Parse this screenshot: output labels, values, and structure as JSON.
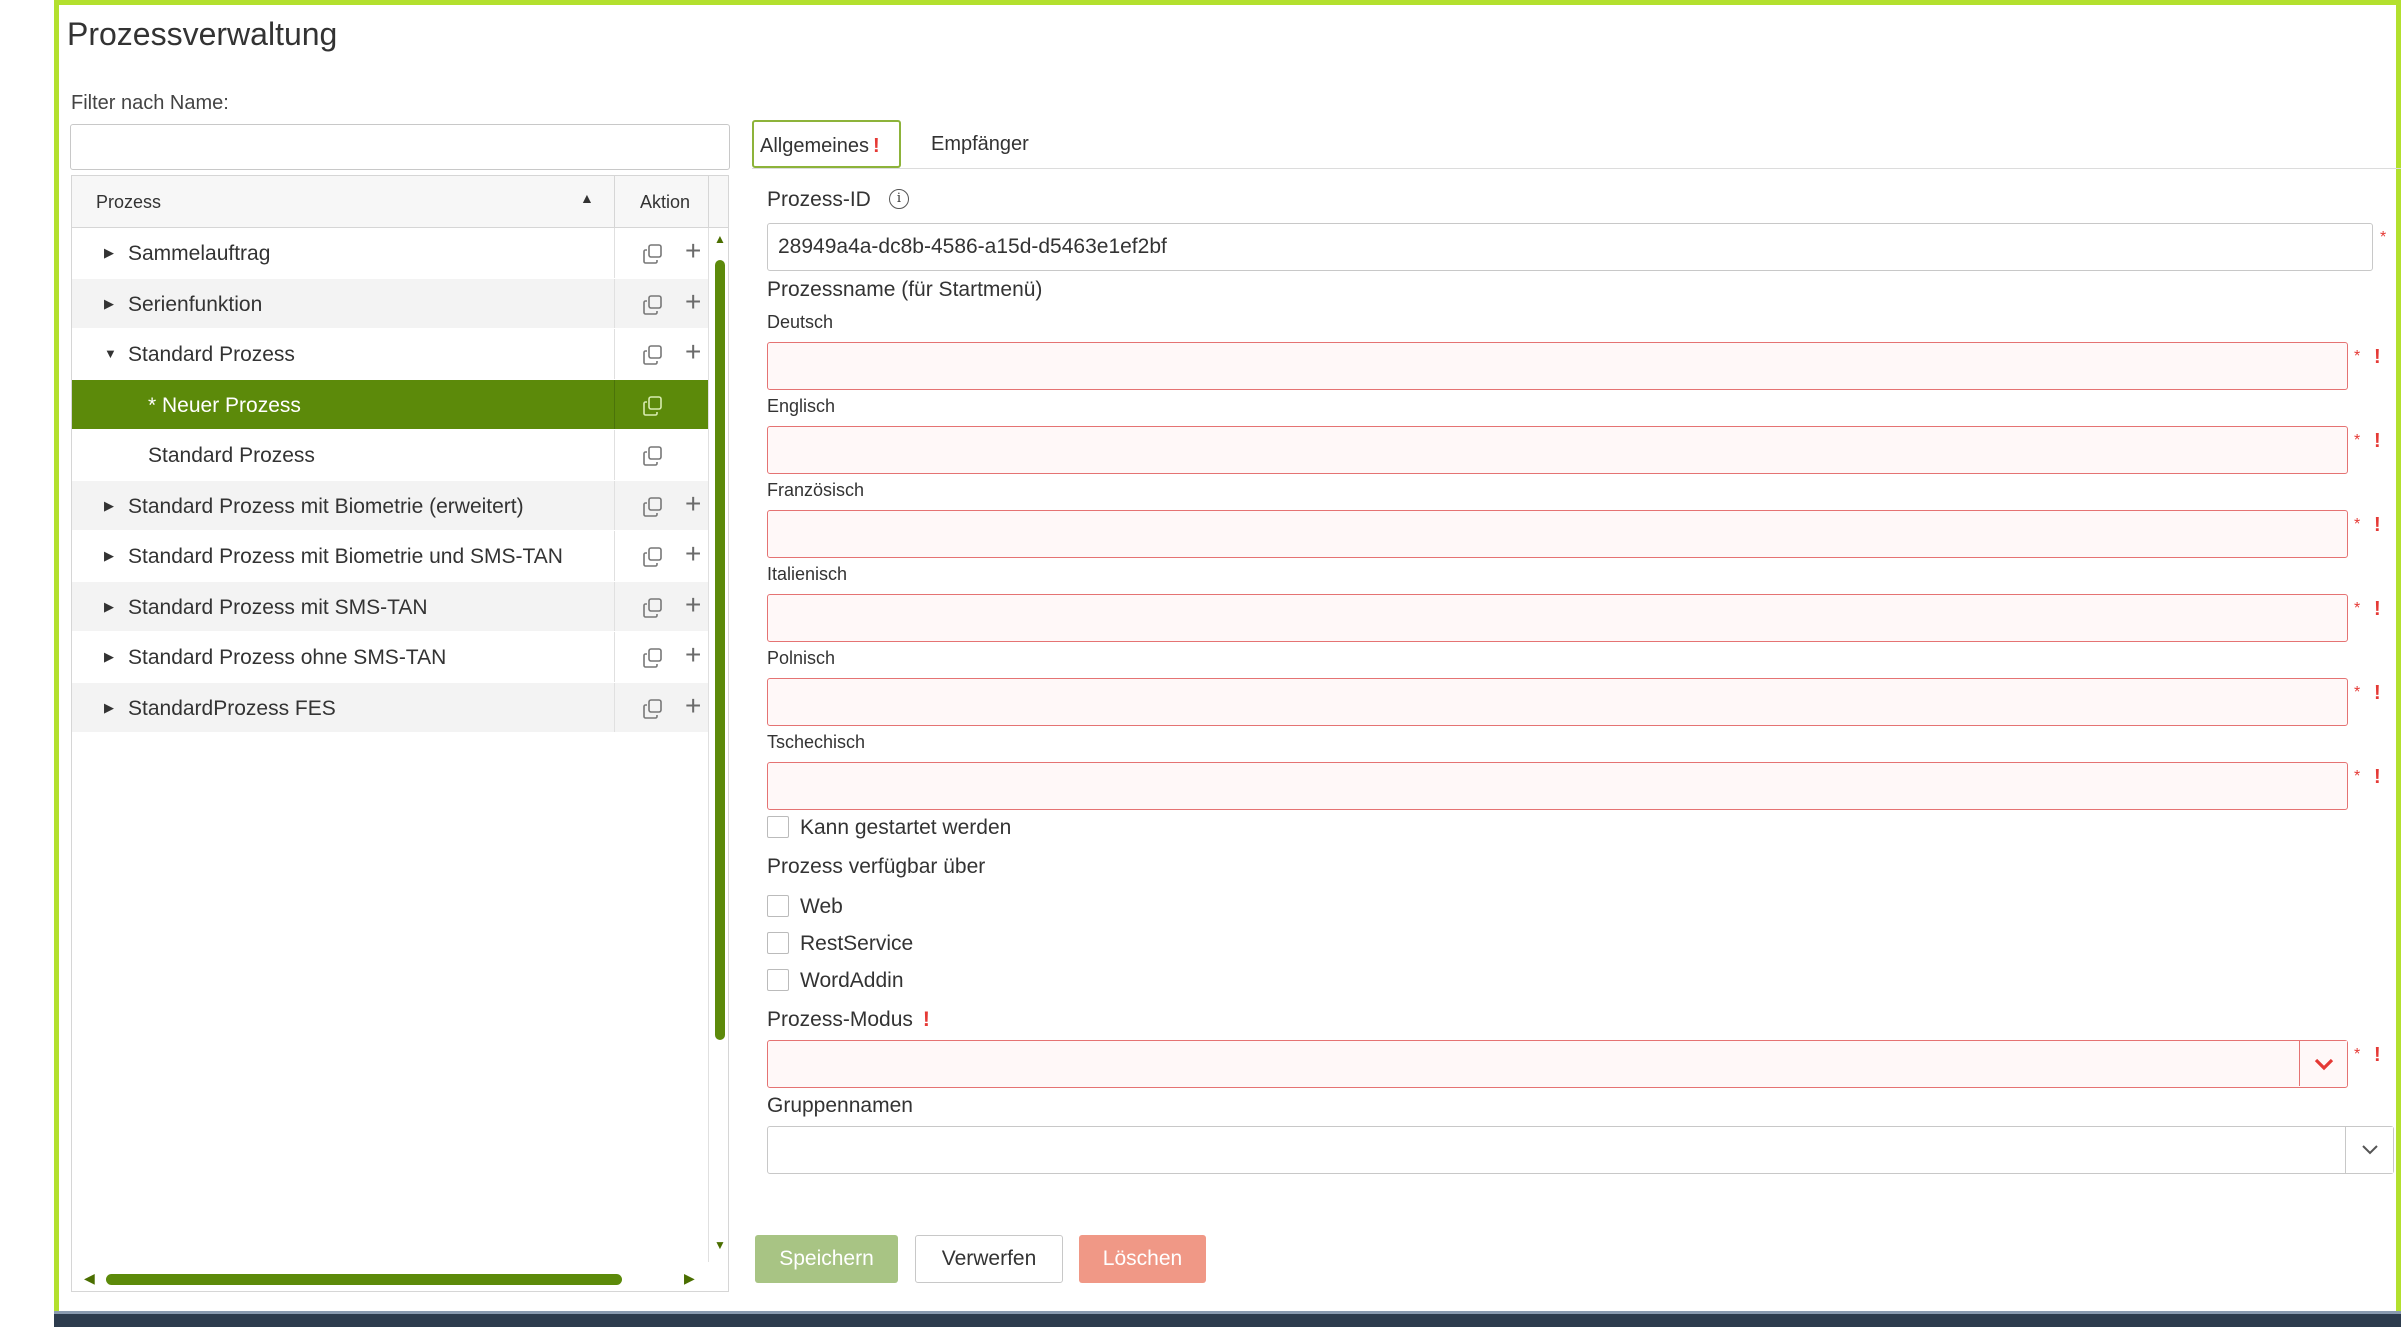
{
  "page": {
    "title": "Prozessverwaltung"
  },
  "filter": {
    "label": "Filter nach Name:",
    "value": ""
  },
  "tree": {
    "columns": {
      "process": "Prozess",
      "action": "Aktion"
    },
    "rows": [
      {
        "label": "Sammelauftrag",
        "expanded": false,
        "level": 0
      },
      {
        "label": "Serienfunktion",
        "expanded": false,
        "level": 0
      },
      {
        "label": "Standard Prozess",
        "expanded": true,
        "level": 0
      },
      {
        "label": "* Neuer Prozess",
        "level": 1,
        "selected": true
      },
      {
        "label": "Standard Prozess",
        "level": 1
      },
      {
        "label": "Standard Prozess mit Biometrie (erweitert)",
        "expanded": false,
        "level": 0
      },
      {
        "label": "Standard Prozess mit Biometrie und SMS-TAN",
        "expanded": false,
        "level": 0
      },
      {
        "label": "Standard Prozess mit SMS-TAN",
        "expanded": false,
        "level": 0
      },
      {
        "label": "Standard Prozess ohne SMS-TAN",
        "expanded": false,
        "level": 0
      },
      {
        "label": "StandardProzess FES",
        "expanded": false,
        "level": 0
      }
    ]
  },
  "tabs": {
    "general": "Allgemeines",
    "general_marker": "!",
    "recipients": "Empfänger"
  },
  "form": {
    "process_id_label": "Prozess-ID",
    "process_id_value": "28949a4a-dc8b-4586-a15d-d5463e1ef2bf",
    "process_name_label": "Prozessname (für Startmenü)",
    "languages": [
      "Deutsch",
      "Englisch",
      "Französisch",
      "Italienisch",
      "Polnisch",
      "Tschechisch"
    ],
    "required_star": "*",
    "error_marker": "!",
    "can_start_label": "Kann gestartet werden",
    "available_via_label": "Prozess verfügbar über",
    "channels": [
      "Web",
      "RestService",
      "WordAddin"
    ],
    "mode_label": "Prozess-Modus",
    "group_label": "Gruppennamen"
  },
  "buttons": {
    "save": "Speichern",
    "discard": "Verwerfen",
    "delete": "Löschen"
  },
  "colors": {
    "frame": "#b3e02e",
    "accent": "#5c8a0a",
    "error": "#e53935"
  }
}
